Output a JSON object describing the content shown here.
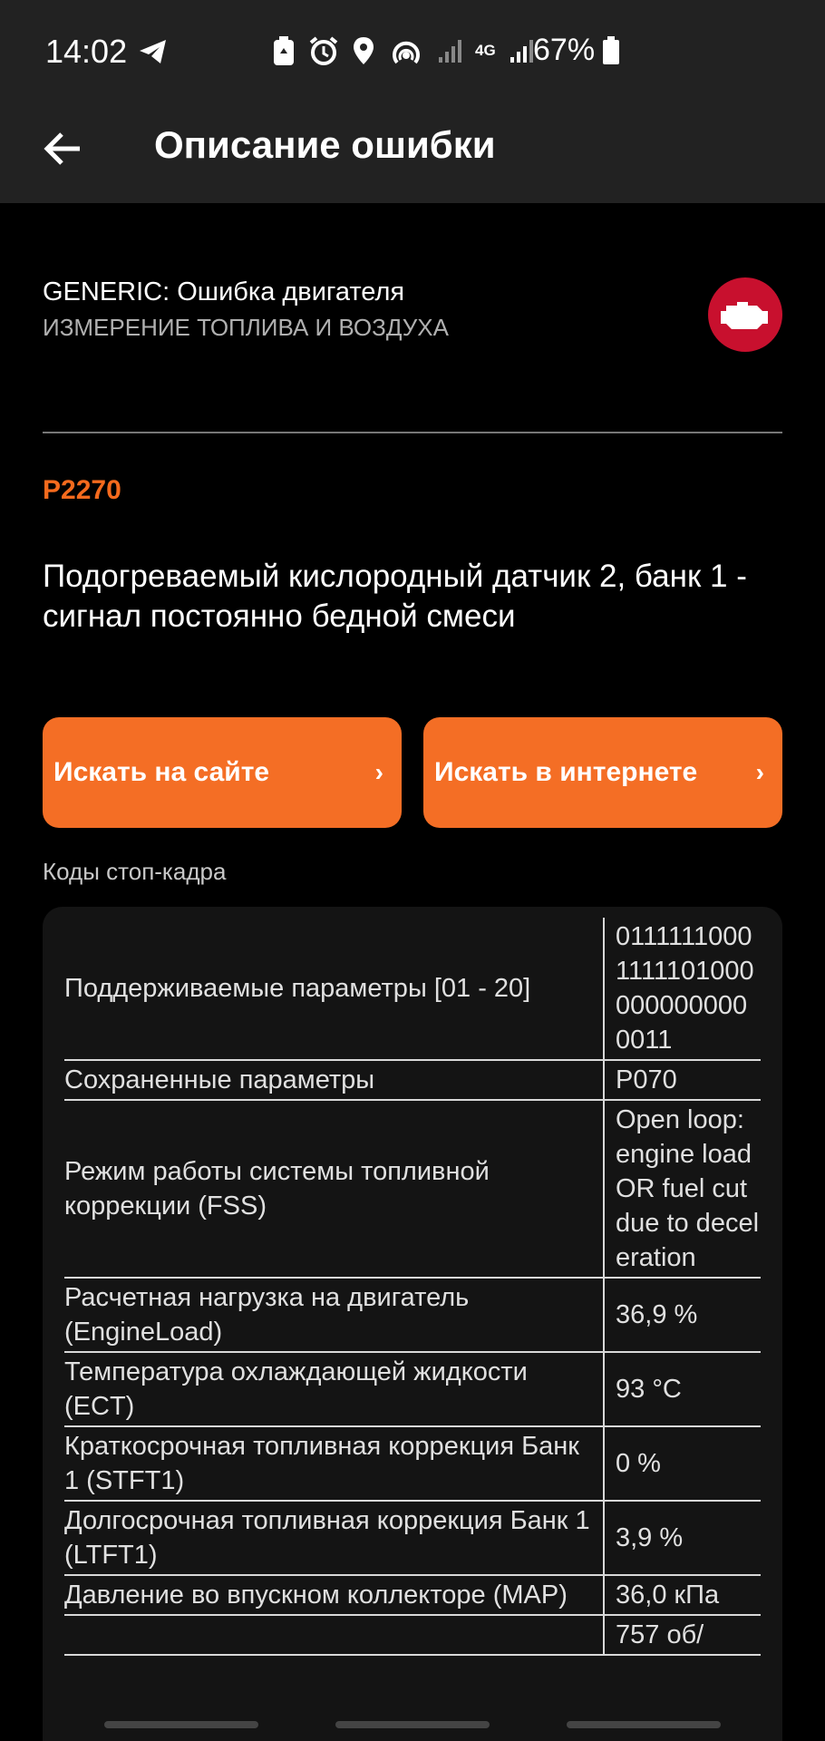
{
  "status_bar": {
    "time": "14:02",
    "battery": "67%",
    "network": "4G"
  },
  "app_bar": {
    "title": "Описание ошибки"
  },
  "error": {
    "type": "GENERIC: Ошибка двигателя",
    "category": "ИЗМЕРЕНИЕ ТОПЛИВА И ВОЗДУХА",
    "code": "P2270",
    "description": "Подогреваемый кислородный датчик 2, банк 1 - сигнал постоянно бедной смеси"
  },
  "buttons": {
    "search_site": "Искать на сайте",
    "search_web": "Искать в интернете",
    "chevron": "›"
  },
  "freeze_frame": {
    "label": "Коды стоп-кадра",
    "rows": [
      {
        "param": "Поддерживаемые параметры [01 - 20]",
        "value": "011111100011111010000000000000011"
      },
      {
        "param": "Сохраненные параметры",
        "value": "P070"
      },
      {
        "param": "Режим работы системы топливной коррекции (FSS)",
        "value": "Open loop: engine load OR fuel cut due to deceleration"
      },
      {
        "param": "Расчетная нагрузка на двигатель (EngineLoad)",
        "value": "36,9 %"
      },
      {
        "param": "Температура охлаждающей жидкости (ECT)",
        "value": "93 °C"
      },
      {
        "param": "Краткосрочная топливная коррекция Банк 1 (STFT1)",
        "value": "0 %"
      },
      {
        "param": "Долгосрочная топливная коррекция Банк 1 (LTFT1)",
        "value": "3,9 %"
      },
      {
        "param": "Давление во впускном коллекторе (MAP)",
        "value": "36,0 кПа"
      },
      {
        "param": "",
        "value": "757 об/"
      }
    ]
  },
  "colors": {
    "accent": "#f46e25",
    "code": "#f56a1d",
    "badge": "#c8102e",
    "appbar": "#222222"
  }
}
